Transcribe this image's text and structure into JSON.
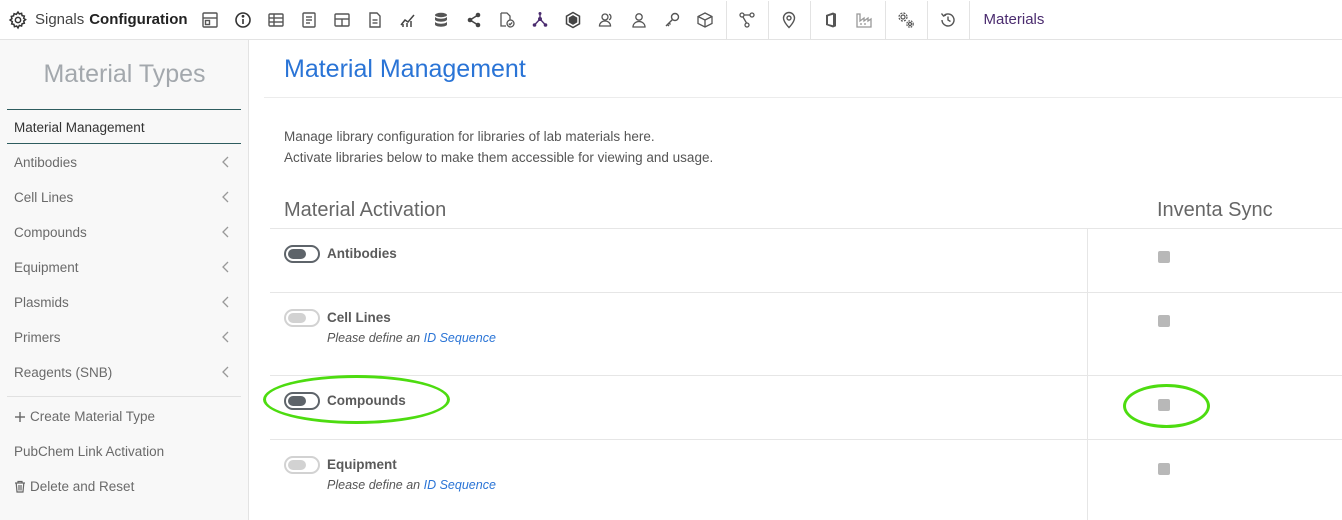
{
  "app": {
    "brand_prefix": "Signals",
    "brand_bold": "Configuration",
    "breadcrumb": "Materials"
  },
  "toolbar": {
    "icons": [
      "dashboard-icon",
      "info-icon",
      "table-icon",
      "document-icon",
      "grid-icon",
      "file-icon",
      "chart-icon",
      "database-icon",
      "share-icon",
      "file-check-icon",
      "network-icon",
      "hexagon-icon",
      "user-group-icon",
      "user-icon",
      "key-icon",
      "cube-icon",
      "workflow-icon",
      "location-icon",
      "office-icon",
      "factory-icon",
      "settings-gears-icon",
      "history-icon"
    ]
  },
  "sidebar": {
    "title": "Material Types",
    "items": [
      {
        "label": "Material Management"
      },
      {
        "label": "Antibodies"
      },
      {
        "label": "Cell Lines"
      },
      {
        "label": "Compounds"
      },
      {
        "label": "Equipment"
      },
      {
        "label": "Plasmids"
      },
      {
        "label": "Primers"
      },
      {
        "label": "Reagents (SNB)"
      }
    ],
    "actions": {
      "create": "Create Material Type",
      "pubchem": "PubChem Link Activation",
      "delete": "Delete and Reset"
    }
  },
  "main": {
    "title": "Material Management",
    "desc_line1": "Manage library configuration for libraries of lab materials here.",
    "desc_line2": "Activate libraries below to make them accessible for viewing and usage.",
    "col_activation": "Material Activation",
    "col_sync": "Inventa Sync",
    "materials": [
      {
        "name": "Antibodies",
        "enabled": true,
        "note": "",
        "link": ""
      },
      {
        "name": "Cell Lines",
        "enabled": false,
        "note": "Please define an",
        "link": "ID Sequence"
      },
      {
        "name": "Compounds",
        "enabled": true,
        "note": "",
        "link": ""
      },
      {
        "name": "Equipment",
        "enabled": false,
        "note": "Please define an",
        "link": "ID Sequence"
      }
    ]
  },
  "colors": {
    "accent": "#2a74d6",
    "highlight_ring": "#4ddc10",
    "breadcrumb": "#4b2c6f"
  }
}
